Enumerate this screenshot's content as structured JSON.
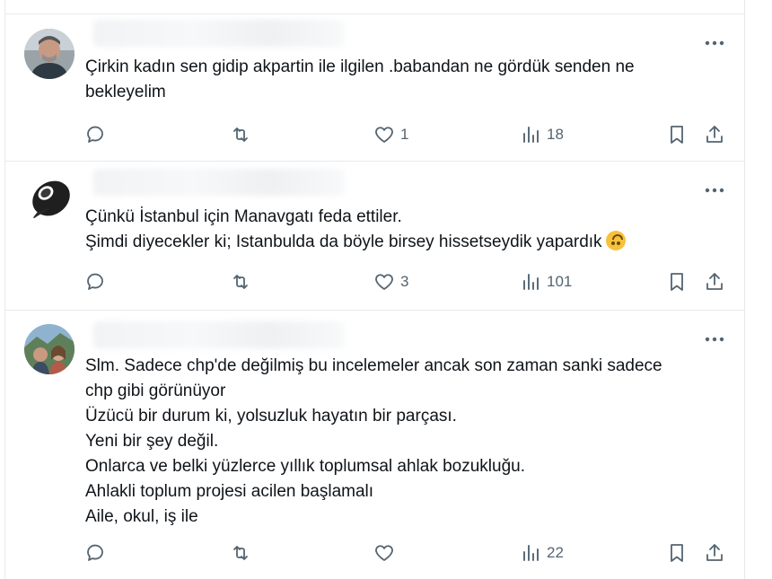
{
  "posts": [
    {
      "avatar": "man-portrait",
      "lines": [
        "Çirkin kadın sen gidip akpartin ile ilgilen .babandan ne gördük senden ne",
        "bekleyelim"
      ],
      "emoji": "",
      "actions": {
        "reply": "",
        "repost": "",
        "like": "1",
        "views": "18"
      }
    },
    {
      "avatar": "black-tape-roll",
      "lines": [
        "Çünkü İstanbul için Manavgatı feda ettiler.",
        "Şimdi diyecekler ki; Istanbulda da böyle birsey hissetseydik yapardık"
      ],
      "emoji": "upside-down-face",
      "actions": {
        "reply": "",
        "repost": "",
        "like": "3",
        "views": "101"
      }
    },
    {
      "avatar": "couple-photo",
      "lines": [
        "Slm. Sadece chp'de değilmiş bu incelemeler ancak son zaman sanki sadece",
        "chp gibi görünüyor",
        "Üzücü bir durum ki, yolsuzluk hayatın bir parçası.",
        "Yeni bir şey değil.",
        "Onlarca ve belki yüzlerce yıllık toplumsal ahlak bozukluğu.",
        "Ahlakli toplum projesi acilen başlamalı",
        "Aile, okul, iş ile"
      ],
      "emoji": "",
      "actions": {
        "reply": "",
        "repost": "",
        "like": "",
        "views": "22"
      }
    }
  ],
  "colors": {
    "text": "#0f1419",
    "muted": "#536471",
    "divider": "#e6e9ec"
  }
}
